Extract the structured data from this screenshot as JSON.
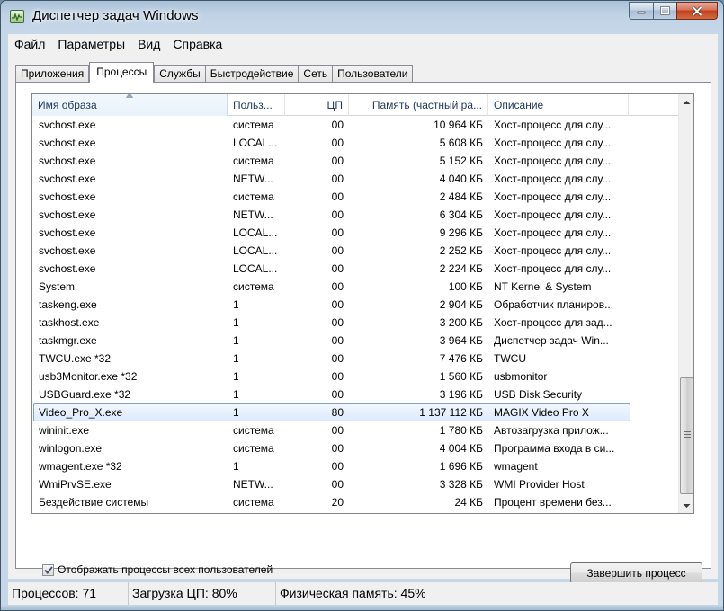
{
  "window": {
    "title": "Диспетчер задач Windows"
  },
  "menu": [
    "Файл",
    "Параметры",
    "Вид",
    "Справка"
  ],
  "tabs": [
    {
      "label": "Приложения",
      "active": false
    },
    {
      "label": "Процессы",
      "active": true
    },
    {
      "label": "Службы",
      "active": false
    },
    {
      "label": "Быстродействие",
      "active": false
    },
    {
      "label": "Сеть",
      "active": false
    },
    {
      "label": "Пользователи",
      "active": false
    }
  ],
  "columns": {
    "name": "Имя образа",
    "user": "Польз...",
    "cpu": "ЦП",
    "mem": "Память (частный ра...",
    "desc": "Описание"
  },
  "processes": [
    {
      "name": "svchost.exe",
      "user": "система",
      "cpu": "00",
      "mem": "10 964 КБ",
      "desc": "Хост-процесс для слу..."
    },
    {
      "name": "svchost.exe",
      "user": "LOCAL...",
      "cpu": "00",
      "mem": "5 608 КБ",
      "desc": "Хост-процесс для слу..."
    },
    {
      "name": "svchost.exe",
      "user": "система",
      "cpu": "00",
      "mem": "5 152 КБ",
      "desc": "Хост-процесс для слу..."
    },
    {
      "name": "svchost.exe",
      "user": "NETW...",
      "cpu": "00",
      "mem": "4 040 КБ",
      "desc": "Хост-процесс для слу..."
    },
    {
      "name": "svchost.exe",
      "user": "система",
      "cpu": "00",
      "mem": "2 484 КБ",
      "desc": "Хост-процесс для слу..."
    },
    {
      "name": "svchost.exe",
      "user": "NETW...",
      "cpu": "00",
      "mem": "6 304 КБ",
      "desc": "Хост-процесс для слу..."
    },
    {
      "name": "svchost.exe",
      "user": "LOCAL...",
      "cpu": "00",
      "mem": "9 296 КБ",
      "desc": "Хост-процесс для слу..."
    },
    {
      "name": "svchost.exe",
      "user": "LOCAL...",
      "cpu": "00",
      "mem": "2 252 КБ",
      "desc": "Хост-процесс для слу..."
    },
    {
      "name": "svchost.exe",
      "user": "LOCAL...",
      "cpu": "00",
      "mem": "2 224 КБ",
      "desc": "Хост-процесс для слу..."
    },
    {
      "name": "System",
      "user": "система",
      "cpu": "00",
      "mem": "100 КБ",
      "desc": "NT Kernel & System"
    },
    {
      "name": "taskeng.exe",
      "user": "1",
      "cpu": "00",
      "mem": "2 904 КБ",
      "desc": "Обработчик планиров..."
    },
    {
      "name": "taskhost.exe",
      "user": "1",
      "cpu": "00",
      "mem": "3 200 КБ",
      "desc": "Хост-процесс для зад..."
    },
    {
      "name": "taskmgr.exe",
      "user": "1",
      "cpu": "00",
      "mem": "3 964 КБ",
      "desc": "Диспетчер задач Win..."
    },
    {
      "name": "TWCU.exe *32",
      "user": "1",
      "cpu": "00",
      "mem": "7 476 КБ",
      "desc": "TWCU"
    },
    {
      "name": "usb3Monitor.exe *32",
      "user": "1",
      "cpu": "00",
      "mem": "1 560 КБ",
      "desc": "usbmonitor"
    },
    {
      "name": "USBGuard.exe *32",
      "user": "1",
      "cpu": "00",
      "mem": "3 196 КБ",
      "desc": "USB Disk Security"
    },
    {
      "name": "Video_Pro_X.exe",
      "user": "1",
      "cpu": "80",
      "mem": "1 137 112 КБ",
      "desc": "MAGIX Video Pro X",
      "selected": true
    },
    {
      "name": "wininit.exe",
      "user": "система",
      "cpu": "00",
      "mem": "1 780 КБ",
      "desc": "Автозагрузка прилож..."
    },
    {
      "name": "winlogon.exe",
      "user": "система",
      "cpu": "00",
      "mem": "4 004 КБ",
      "desc": "Программа входа в си..."
    },
    {
      "name": "wmagent.exe *32",
      "user": "1",
      "cpu": "00",
      "mem": "1 696 КБ",
      "desc": "wmagent"
    },
    {
      "name": "WmiPrvSE.exe",
      "user": "NETW...",
      "cpu": "00",
      "mem": "3 328 КБ",
      "desc": "WMI Provider Host"
    },
    {
      "name": "Бездействие системы",
      "user": "система",
      "cpu": "20",
      "mem": "24 КБ",
      "desc": "Процент времени без..."
    }
  ],
  "show_all_users": {
    "label": "Отображать процессы всех пользователей",
    "checked": true
  },
  "end_task_label": "Завершить процесс",
  "status": {
    "processes": "Процессов: 71",
    "cpu": "Загрузка ЦП: 80%",
    "memory": "Физическая память: 45%"
  }
}
